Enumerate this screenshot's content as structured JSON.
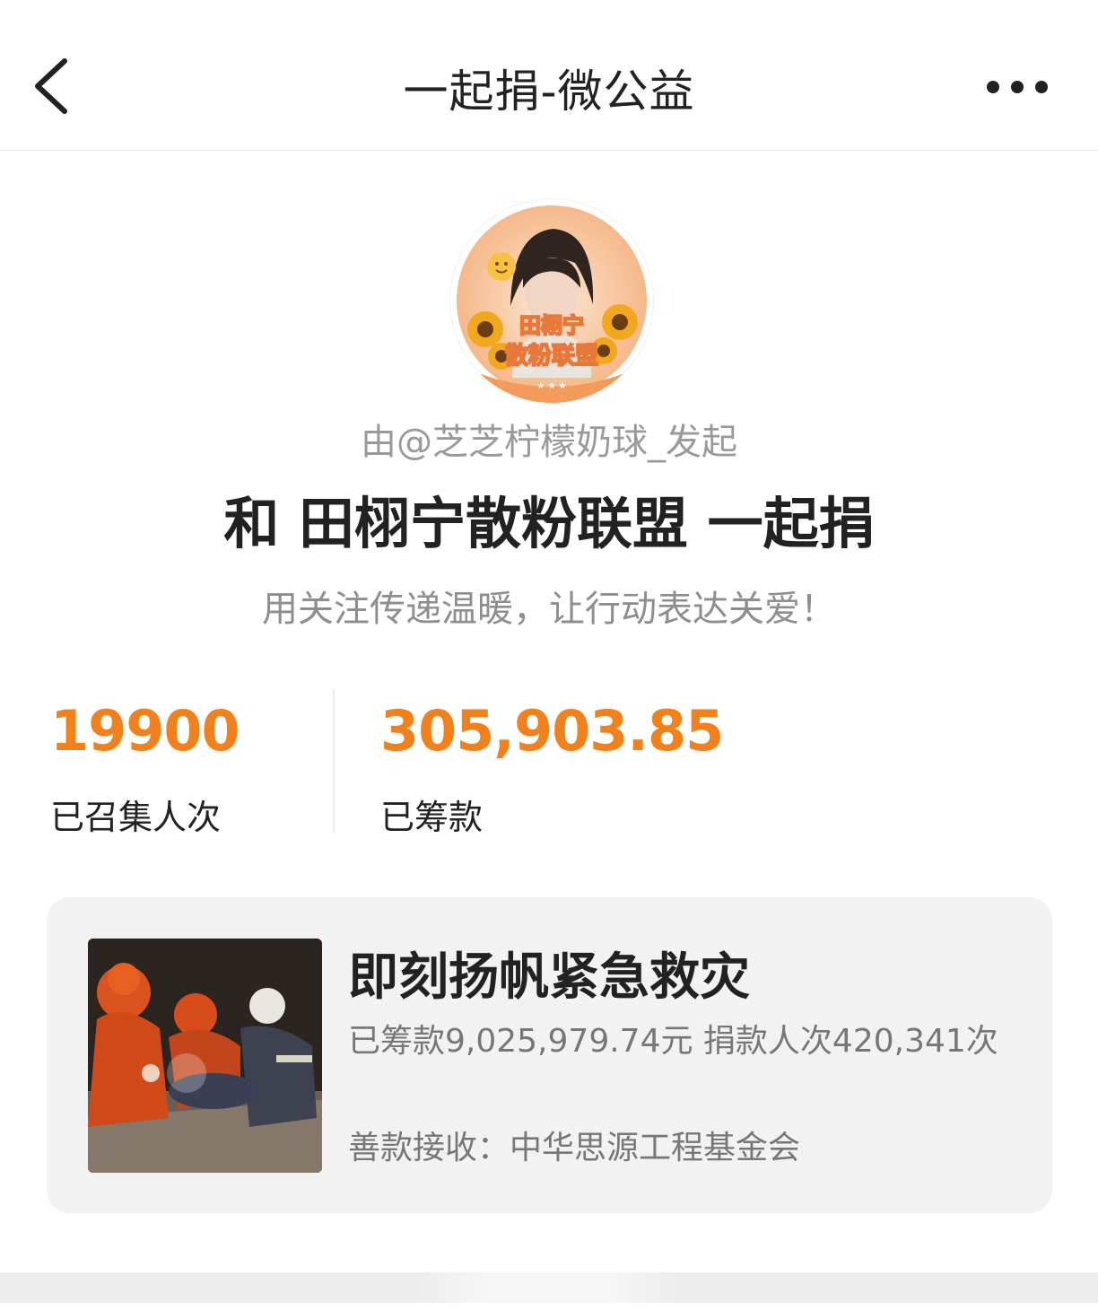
{
  "header": {
    "title": "一起捐-微公益",
    "back_icon": "chevron-left-icon",
    "more_icon": "more-horizontal-icon"
  },
  "avatar": {
    "badge_line1": "田栩宁",
    "badge_line2": "散粉联盟"
  },
  "initiator": "由@芝芝柠檬奶球_发起",
  "headline": "和 田栩宁散粉联盟 一起捐",
  "slogan": "用关注传递温暖，让行动表达关爱！",
  "stats": {
    "people_value": "19900",
    "people_label": "已召集人次",
    "amount_value": "305,903.85",
    "amount_label": "已筹款"
  },
  "project": {
    "title": "即刻扬帆紧急救灾",
    "stats_text": "已筹款9,025,979.74元  捐款人次420,341次",
    "receiver": "善款接收：中华思源工程基金会"
  },
  "colors": {
    "accent": "#f0811c",
    "card_bg": "#f2f2f2"
  }
}
